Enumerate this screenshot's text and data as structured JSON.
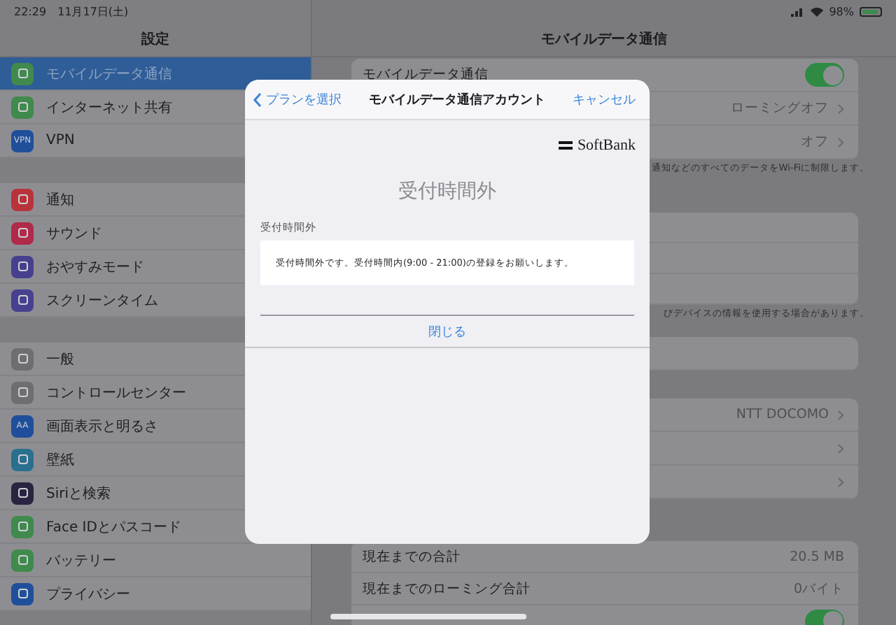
{
  "status_bar": {
    "time": "22:29",
    "date": "11月17日(土)",
    "battery": "98%"
  },
  "sidebar": {
    "title": "設定",
    "groups": [
      [
        {
          "label": "モバイルデータ通信",
          "selected": true,
          "color": "#3f8a4c"
        },
        {
          "label": "インターネット共有",
          "selected": false,
          "color": "#3f8a4c"
        },
        {
          "label": "VPN",
          "selected": false,
          "color": "#1f4f9a",
          "icon_text": "VPN"
        }
      ],
      [
        {
          "label": "通知",
          "selected": false,
          "color": "#b8343a"
        },
        {
          "label": "サウンド",
          "selected": false,
          "color": "#b02a4a"
        },
        {
          "label": "おやすみモード",
          "selected": false,
          "color": "#47408e"
        },
        {
          "label": "スクリーンタイム",
          "selected": false,
          "color": "#47408e"
        }
      ],
      [
        {
          "label": "一般",
          "selected": false,
          "color": "#6e6e72"
        },
        {
          "label": "コントロールセンター",
          "selected": false,
          "color": "#6e6e72"
        },
        {
          "label": "画面表示と明るさ",
          "selected": false,
          "color": "#1f4f9a",
          "icon_text": "AA"
        },
        {
          "label": "壁紙",
          "selected": false,
          "color": "#2a6f8e"
        },
        {
          "label": "Siriと検索",
          "selected": false,
          "color": "#2a2440"
        },
        {
          "label": "Face IDとパスコード",
          "selected": false,
          "color": "#3f8a4c"
        },
        {
          "label": "バッテリー",
          "selected": false,
          "color": "#3f8a4c"
        },
        {
          "label": "プライバシー",
          "selected": false,
          "color": "#1f4f9a"
        }
      ]
    ]
  },
  "detail": {
    "title": "モバイルデータ通信",
    "groups": [
      {
        "rows": [
          {
            "kind": "toggle",
            "label": "モバイルデータ通信",
            "on": true
          },
          {
            "kind": "link",
            "value": "ローミングオフ",
            "chevron": true
          },
          {
            "kind": "link",
            "value": "オフ",
            "chevron": true
          }
        ],
        "footnote": "通知などのすべてのデータをWi-Fiに制限します。"
      },
      {
        "rows": [
          {
            "kind": "blank"
          },
          {
            "kind": "blank"
          },
          {
            "kind": "blank"
          }
        ],
        "footnote": "びデバイスの情報を使用する場合があります。"
      },
      {
        "rows": [
          {
            "kind": "blank"
          }
        ]
      },
      {
        "rows": [
          {
            "kind": "link",
            "value": "NTT DOCOMO",
            "chevron": true
          },
          {
            "kind": "link",
            "chevron": true
          },
          {
            "kind": "link",
            "chevron": true
          }
        ]
      },
      {
        "rows": [
          {
            "kind": "link",
            "label": "現在までの合計",
            "value": "20.5 MB",
            "chevron": false
          },
          {
            "kind": "link",
            "label": "現在までのローミング合計",
            "value": "0バイト",
            "chevron": false
          },
          {
            "kind": "toggle",
            "on": true
          }
        ]
      }
    ]
  },
  "modal": {
    "back": "プランを選択",
    "title": "モバイルデータ通信アカウント",
    "cancel": "キャンセル",
    "brand": "SoftBank",
    "heading": "受付時間外",
    "section_label": "受付時間外",
    "message": "受付時間外です。受付時間内(9:00 - 21:00)の登録をお願いします。",
    "close": "閉じる"
  }
}
